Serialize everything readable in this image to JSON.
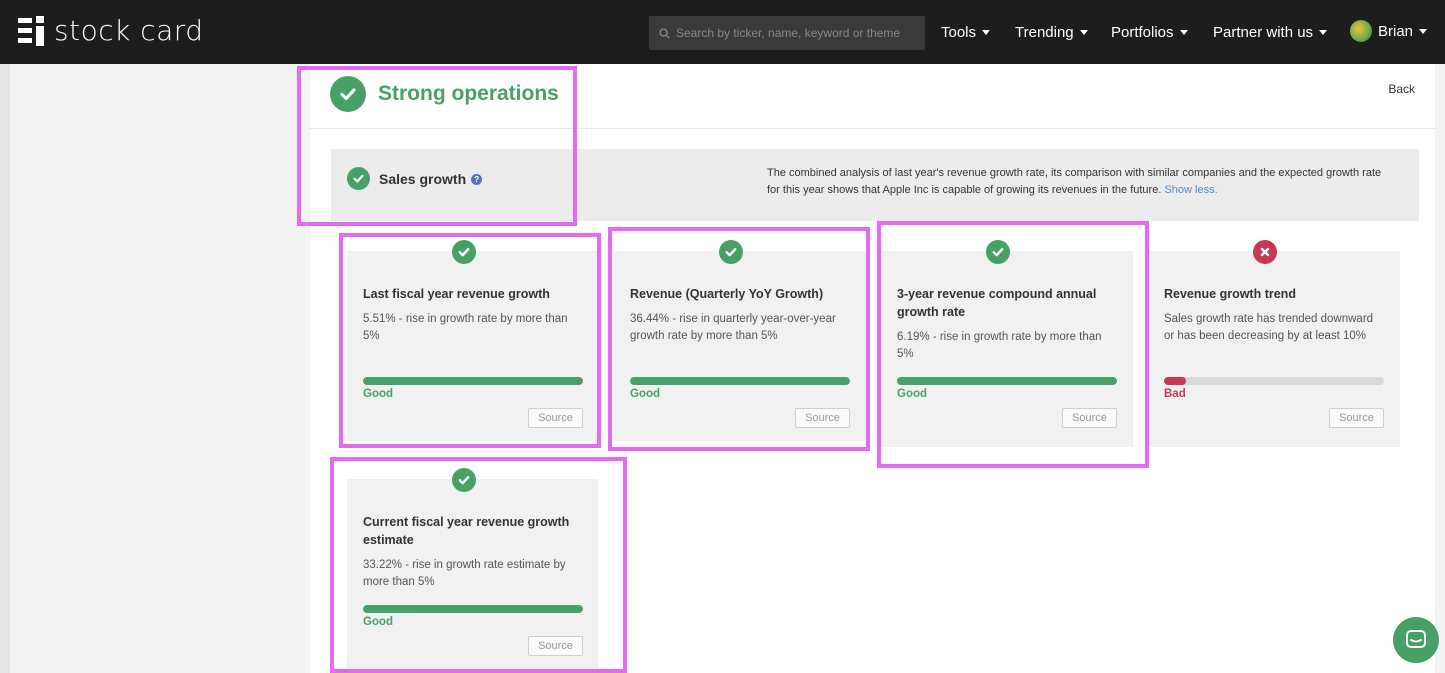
{
  "app": {
    "brand": "stock card",
    "user": "Brian"
  },
  "search": {
    "placeholder": "Search by ticker, name, keyword or theme"
  },
  "nav": {
    "tools": "Tools",
    "trending": "Trending",
    "portfolios": "Portfolios",
    "partner": "Partner with us"
  },
  "section": {
    "title": "Strong operations",
    "back": "Back"
  },
  "panel": {
    "title": "Sales growth",
    "description": "The combined analysis of last year's revenue growth rate, its comparison with similar companies and the expected growth rate for this year shows that Apple Inc is capable of growing its revenues in the future.",
    "show_less": "Show less."
  },
  "cards": [
    {
      "title": "Last fiscal year revenue growth",
      "desc": "5.51% - rise in growth rate by more than 5%",
      "verdict": "Good",
      "status": "pass",
      "fill": 1.0,
      "source": "Source"
    },
    {
      "title": "Revenue (Quarterly YoY Growth)",
      "desc": "36.44% - rise in quarterly year-over-year growth rate by more than 5%",
      "verdict": "Good",
      "status": "pass",
      "fill": 1.0,
      "source": "Source"
    },
    {
      "title": "3-year revenue compound annual growth rate",
      "desc": "6.19% - rise in growth rate by more than 5%",
      "verdict": "Good",
      "status": "pass",
      "fill": 1.0,
      "source": "Source"
    },
    {
      "title": "Revenue growth trend",
      "desc": "Sales growth rate has trended downward or has been decreasing by at least 10%",
      "verdict": "Bad",
      "status": "fail",
      "fill": 0.1,
      "source": "Source"
    },
    {
      "title": "Current fiscal year revenue growth estimate",
      "desc": "33.22% - rise in growth rate estimate by more than 5%",
      "verdict": "Good",
      "status": "pass",
      "fill": 1.0,
      "source": "Source"
    }
  ],
  "colors": {
    "good": "#47a065",
    "bad": "#c73855",
    "highlight": "#e36af1",
    "topbar": "#1d1d1d"
  }
}
